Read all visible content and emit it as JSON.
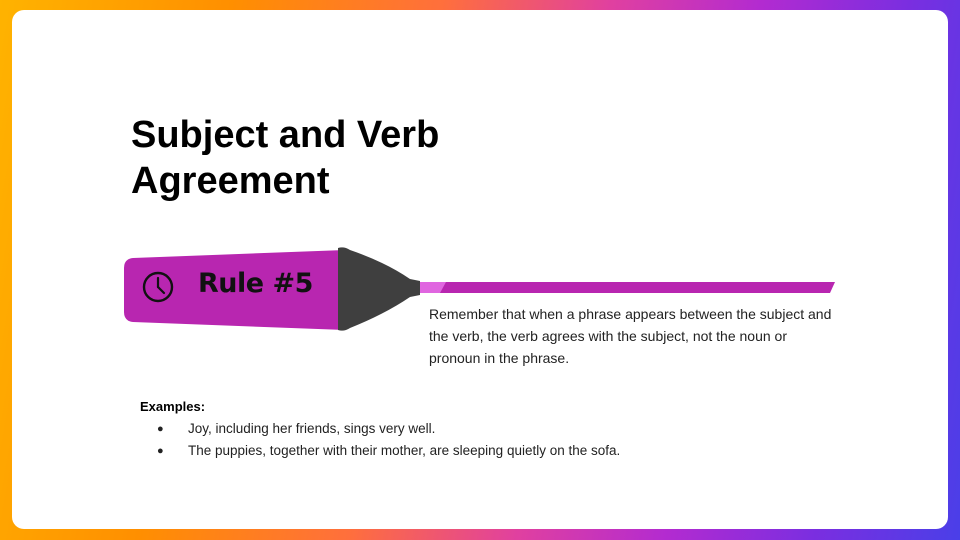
{
  "slide": {
    "title": "Subject and Verb Agreement",
    "rule_label": "Rule #5",
    "description": "Remember that when a phrase appears between the subject and the verb, the verb agrees with the subject, not the noun or pronoun in the phrase.",
    "examples": {
      "heading": "Examples:",
      "items": [
        "Joy, including her friends, sings very well.",
        "The puppies, together with their mother, are sleeping quietly on the sofa."
      ]
    }
  },
  "icons": {
    "rule_icon": "clock-icon",
    "marker_graphic": "highlighter-marker",
    "bullet": "bullet-dot-icon"
  },
  "colors": {
    "marker_body": "#b826b0",
    "marker_tip": "#3f3f3f",
    "marker_highlight": "#e066e0",
    "accent_line": "#b826b0"
  }
}
